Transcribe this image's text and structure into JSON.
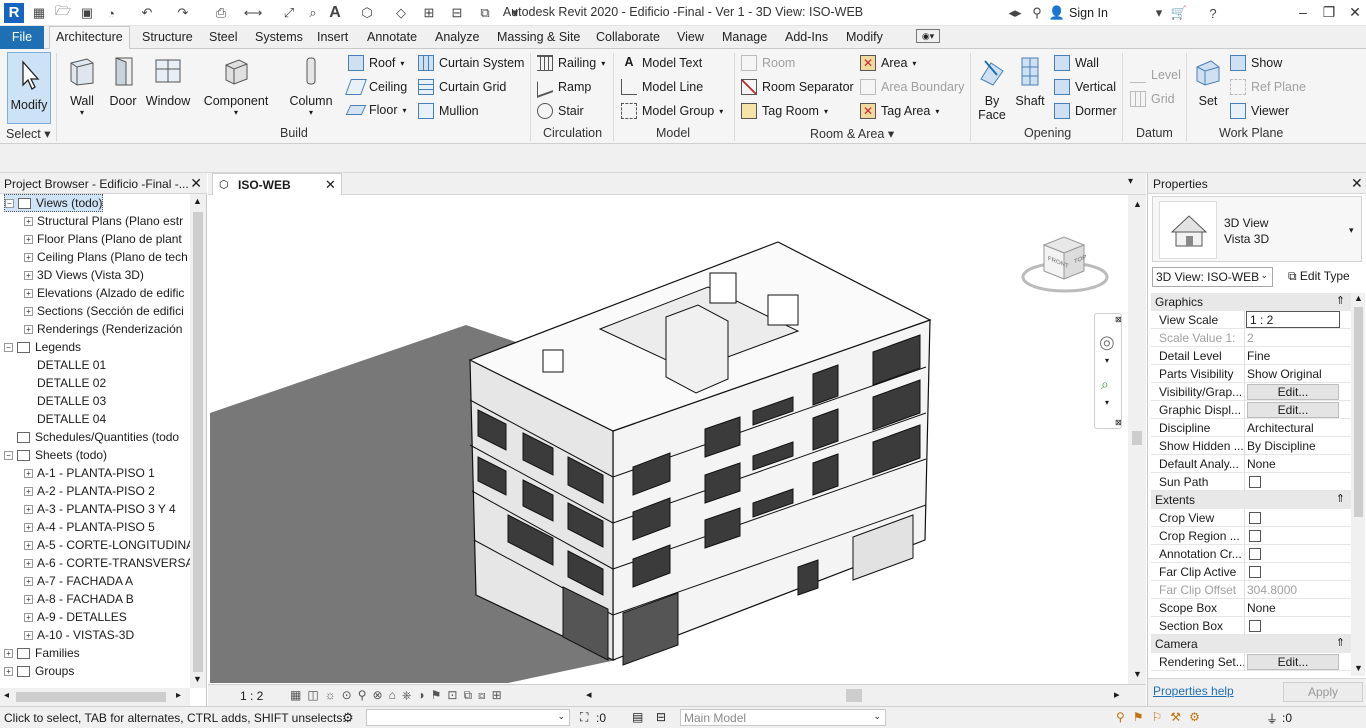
{
  "title_bar": {
    "app_title": "Autodesk Revit 2020 - Edificio -Final - Ver 1 - 3D View: ISO-WEB",
    "sign_in": "Sign In"
  },
  "ribbon_tabs": [
    "File",
    "Architecture",
    "Structure",
    "Steel",
    "Systems",
    "Insert",
    "Annotate",
    "Analyze",
    "Massing & Site",
    "Collaborate",
    "View",
    "Manage",
    "Add-Ins",
    "Modify"
  ],
  "ribbon": {
    "select": {
      "modify_label": "Modify",
      "panel_label": "Select"
    },
    "build": {
      "wall": "Wall",
      "door": "Door",
      "window": "Window",
      "component": "Component",
      "column": "Column",
      "roof": "Roof",
      "ceiling": "Ceiling",
      "floor": "Floor",
      "curtain_system": "Curtain System",
      "curtain_grid": "Curtain Grid",
      "mullion": "Mullion",
      "panel_label": "Build"
    },
    "circulation": {
      "railing": "Railing",
      "ramp": "Ramp",
      "stair": "Stair",
      "panel_label": "Circulation"
    },
    "model": {
      "model_text": "Model Text",
      "model_line": "Model Line",
      "model_group": "Model Group",
      "panel_label": "Model"
    },
    "room_area": {
      "room": "Room",
      "room_separator": "Room Separator",
      "tag_room": "Tag Room",
      "area": "Area",
      "area_boundary": "Area Boundary",
      "tag_area": "Tag Area",
      "panel_label": "Room & Area"
    },
    "opening": {
      "by_face_1": "By",
      "by_face_2": "Face",
      "shaft": "Shaft",
      "wall": "Wall",
      "vertical": "Vertical",
      "dormer": "Dormer",
      "panel_label": "Opening"
    },
    "datum": {
      "level": "Level",
      "grid": "Grid",
      "panel_label": "Datum"
    },
    "work_plane": {
      "set": "Set",
      "show": "Show",
      "ref_plane": "Ref Plane",
      "viewer": "Viewer",
      "panel_label": "Work Plane"
    }
  },
  "project_browser": {
    "title": "Project Browser - Edificio -Final -...",
    "nodes": [
      {
        "label": "Views (todo)",
        "level": 0,
        "expander": "−",
        "icon": "views-icon"
      },
      {
        "label": "Structural Plans (Plano estr",
        "level": 1,
        "expander": "+"
      },
      {
        "label": "Floor Plans (Plano de plant",
        "level": 1,
        "expander": "+"
      },
      {
        "label": "Ceiling Plans (Plano de tech",
        "level": 1,
        "expander": "+"
      },
      {
        "label": "3D Views (Vista 3D)",
        "level": 1,
        "expander": "+"
      },
      {
        "label": "Elevations (Alzado de edific",
        "level": 1,
        "expander": "+"
      },
      {
        "label": "Sections (Sección de edifici",
        "level": 1,
        "expander": "+"
      },
      {
        "label": "Renderings (Renderización",
        "level": 1,
        "expander": "+"
      },
      {
        "label": "Legends",
        "level": 0,
        "expander": "−",
        "icon": "legends-icon"
      },
      {
        "label": "DETALLE 01",
        "level": 1,
        "expander": ""
      },
      {
        "label": "DETALLE 02",
        "level": 1,
        "expander": ""
      },
      {
        "label": "DETALLE 03",
        "level": 1,
        "expander": ""
      },
      {
        "label": "DETALLE 04",
        "level": 1,
        "expander": ""
      },
      {
        "label": "Schedules/Quantities (todo",
        "level": 0,
        "expander": "",
        "icon": "schedule-icon"
      },
      {
        "label": "Sheets (todo)",
        "level": 0,
        "expander": "−",
        "icon": "sheets-icon"
      },
      {
        "label": "A-1 - PLANTA-PISO 1",
        "level": 1,
        "expander": "+"
      },
      {
        "label": "A-2 - PLANTA-PISO 2",
        "level": 1,
        "expander": "+"
      },
      {
        "label": "A-3 - PLANTA-PISO 3 Y 4",
        "level": 1,
        "expander": "+"
      },
      {
        "label": "A-4 - PLANTA-PISO 5",
        "level": 1,
        "expander": "+"
      },
      {
        "label": "A-5 - CORTE-LONGITUDINA",
        "level": 1,
        "expander": "+"
      },
      {
        "label": "A-6 - CORTE-TRANSVERSA",
        "level": 1,
        "expander": "+"
      },
      {
        "label": "A-7 - FACHADA A",
        "level": 1,
        "expander": "+"
      },
      {
        "label": "A-8 - FACHADA B",
        "level": 1,
        "expander": "+"
      },
      {
        "label": "A-9 - DETALLES",
        "level": 1,
        "expander": "+"
      },
      {
        "label": "A-10 - VISTAS-3D",
        "level": 1,
        "expander": "+"
      },
      {
        "label": "Families",
        "level": 0,
        "expander": "+",
        "icon": "families-icon"
      },
      {
        "label": "Groups",
        "level": 0,
        "expander": "+",
        "icon": "groups-icon"
      }
    ]
  },
  "view": {
    "tab_label": "ISO-WEB",
    "scale": "1 : 2",
    "viewcube_top": "TOP",
    "viewcube_front": "FRONT"
  },
  "properties": {
    "title": "Properties",
    "type_line1": "3D View",
    "type_line2": "Vista 3D",
    "selector": "3D View: ISO-WEB",
    "edit_type": "Edit Type",
    "groups": [
      {
        "name": "Graphics",
        "rows": [
          {
            "k": "View Scale",
            "v": "1 : 2",
            "kind": "input"
          },
          {
            "k": "Scale Value    1:",
            "v": "2",
            "kind": "disabled"
          },
          {
            "k": "Detail Level",
            "v": "Fine",
            "kind": "text"
          },
          {
            "k": "Parts Visibility",
            "v": "Show Original",
            "kind": "text"
          },
          {
            "k": "Visibility/Grap...",
            "v": "Edit...",
            "kind": "button"
          },
          {
            "k": "Graphic Displ...",
            "v": "Edit...",
            "kind": "button"
          },
          {
            "k": "Discipline",
            "v": "Architectural",
            "kind": "text"
          },
          {
            "k": "Show Hidden ...",
            "v": "By Discipline",
            "kind": "text"
          },
          {
            "k": "Default Analy...",
            "v": "None",
            "kind": "text"
          },
          {
            "k": "Sun Path",
            "v": "",
            "kind": "check"
          }
        ]
      },
      {
        "name": "Extents",
        "rows": [
          {
            "k": "Crop View",
            "v": "",
            "kind": "check"
          },
          {
            "k": "Crop Region ...",
            "v": "",
            "kind": "check"
          },
          {
            "k": "Annotation Cr...",
            "v": "",
            "kind": "check"
          },
          {
            "k": "Far Clip Active",
            "v": "",
            "kind": "check"
          },
          {
            "k": "Far Clip Offset",
            "v": "304.8000",
            "kind": "disabled"
          },
          {
            "k": "Scope Box",
            "v": "None",
            "kind": "text"
          },
          {
            "k": "Section Box",
            "v": "",
            "kind": "check"
          }
        ]
      },
      {
        "name": "Camera",
        "rows": [
          {
            "k": "Rendering Set...",
            "v": "Edit...",
            "kind": "button"
          }
        ]
      }
    ],
    "help": "Properties help",
    "apply": "Apply"
  },
  "status": {
    "message": "Click to select, TAB for alternates, CTRL adds, SHIFT unselects.",
    "count": ":0",
    "model": "Main Model",
    "filter_count": ":0"
  },
  "colors": {
    "accent": "#1f6fb5",
    "shadow": "#7a7a7a"
  }
}
